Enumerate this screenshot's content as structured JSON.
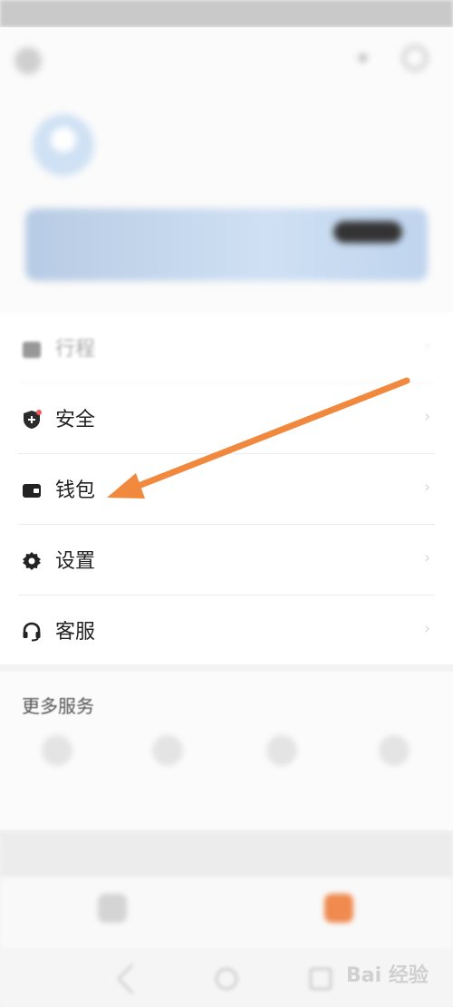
{
  "header": {
    "title": "",
    "user_phone": "",
    "vip_title": "",
    "vip_subtitle": "",
    "vip_button": ""
  },
  "menu": {
    "items": [
      {
        "label": "行程",
        "icon": "calendar-icon"
      },
      {
        "label": "安全",
        "icon": "shield-icon"
      },
      {
        "label": "钱包",
        "icon": "wallet-icon"
      },
      {
        "label": "设置",
        "icon": "gear-icon"
      },
      {
        "label": "客服",
        "icon": "headset-icon"
      }
    ]
  },
  "more_services": {
    "title": "更多服务",
    "items": [
      {
        "label": "",
        "icon": "cart-icon"
      },
      {
        "label": "",
        "icon": "person-icon"
      },
      {
        "label": "",
        "icon": "grid-icon"
      },
      {
        "label": "",
        "icon": "box-icon"
      }
    ]
  },
  "tabs": {
    "home": {
      "label": "",
      "icon": "home-icon"
    },
    "mine": {
      "label": "",
      "icon": "profile-icon"
    }
  },
  "annotation": {
    "color": "#f0883e"
  },
  "watermark": "Bai 经验"
}
